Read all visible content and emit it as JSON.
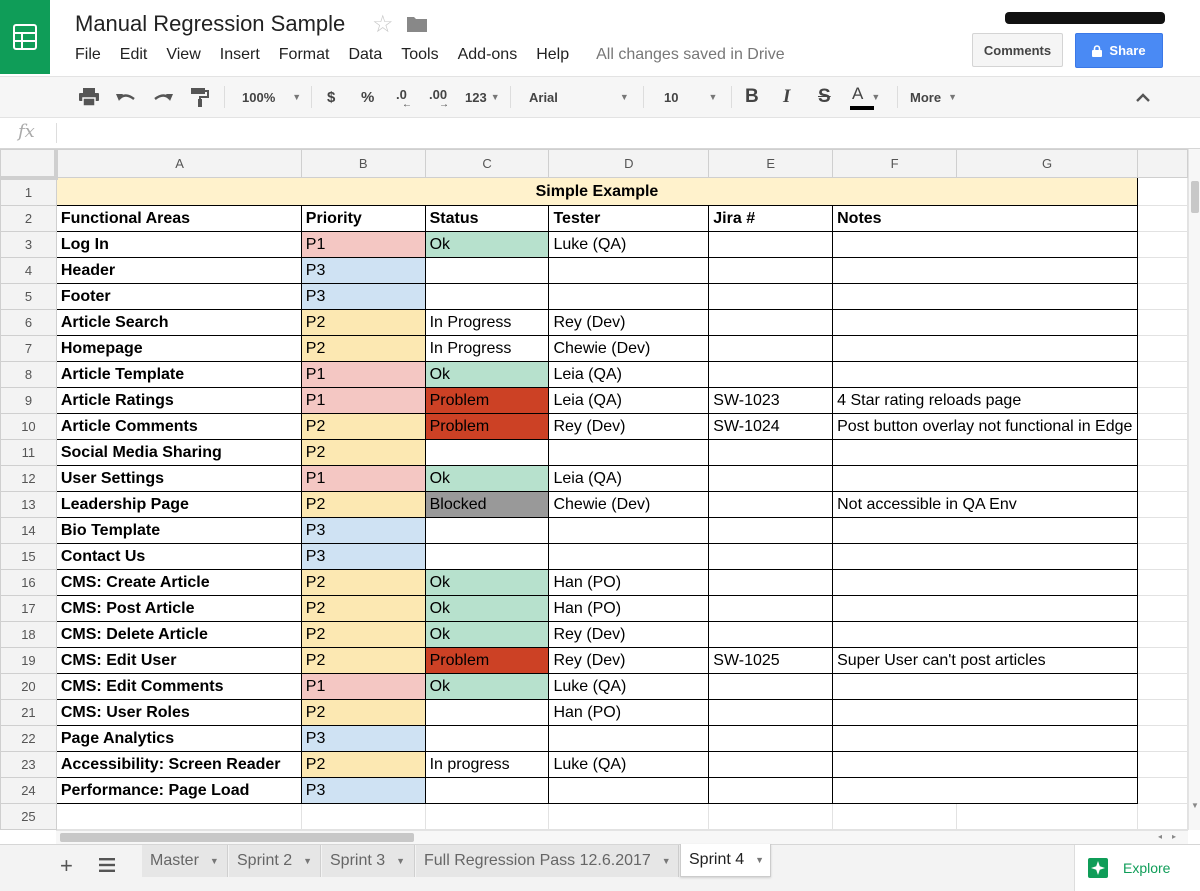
{
  "app": {
    "title": "Manual Regression Sample",
    "save_status": "All changes saved in Drive",
    "menu": [
      "File",
      "Edit",
      "View",
      "Insert",
      "Format",
      "Data",
      "Tools",
      "Add-ons",
      "Help"
    ],
    "comments_label": "Comments",
    "share_label": "Share",
    "accent": "#4a8af4",
    "brand_green": "#0f9d58"
  },
  "toolbar": {
    "zoom": "100%",
    "currency": "$",
    "percent": "%",
    "dec_decrease": ".0",
    "dec_increase": ".00",
    "format_more": "123",
    "font": "Arial",
    "font_size": "10",
    "bold": "B",
    "italic": "I",
    "strike": "S",
    "text_color": "A",
    "more": "More"
  },
  "formula": {
    "fx": "fx",
    "value": ""
  },
  "grid": {
    "columns": [
      "A",
      "B",
      "C",
      "D",
      "E",
      "F",
      "G"
    ],
    "row_numbers": [
      "1",
      "2",
      "3",
      "4",
      "5",
      "6",
      "7",
      "8",
      "9",
      "10",
      "11",
      "12",
      "13",
      "14",
      "15",
      "16",
      "17",
      "18",
      "19",
      "20",
      "21",
      "22",
      "23",
      "24",
      "25"
    ],
    "title": "Simple Example",
    "headers": [
      "Functional Areas",
      "Priority",
      "Status",
      "Tester",
      "Jira #",
      "Notes"
    ],
    "rows": [
      [
        "Log In",
        "P1",
        "Ok",
        "Luke (QA)",
        "",
        ""
      ],
      [
        "Header",
        "P3",
        "",
        "",
        "",
        ""
      ],
      [
        "Footer",
        "P3",
        "",
        "",
        "",
        ""
      ],
      [
        "Article Search",
        "P2",
        "In Progress",
        "Rey (Dev)",
        "",
        ""
      ],
      [
        "Homepage",
        "P2",
        "In Progress",
        "Chewie (Dev)",
        "",
        ""
      ],
      [
        "Article Template",
        "P1",
        "Ok",
        "Leia (QA)",
        "",
        ""
      ],
      [
        "Article Ratings",
        "P1",
        "Problem",
        "Leia (QA)",
        "SW-1023",
        "4 Star rating reloads page"
      ],
      [
        "Article Comments",
        "P2",
        "Problem",
        "Rey (Dev)",
        "SW-1024",
        "Post button overlay not functional in Edge"
      ],
      [
        "Social Media Sharing",
        "P2",
        "",
        "",
        "",
        ""
      ],
      [
        "User Settings",
        "P1",
        "Ok",
        "Leia (QA)",
        "",
        ""
      ],
      [
        "Leadership Page",
        "P2",
        "Blocked",
        "Chewie (Dev)",
        "",
        "Not accessible in QA Env"
      ],
      [
        "Bio Template",
        "P3",
        "",
        "",
        "",
        ""
      ],
      [
        "Contact Us",
        "P3",
        "",
        "",
        "",
        ""
      ],
      [
        "CMS: Create Article",
        "P2",
        "Ok",
        "Han (PO)",
        "",
        ""
      ],
      [
        "CMS: Post Article",
        "P2",
        "Ok",
        "Han (PO)",
        "",
        ""
      ],
      [
        "CMS: Delete Article",
        "P2",
        "Ok",
        "Rey (Dev)",
        "",
        ""
      ],
      [
        "CMS: Edit User",
        "P2",
        "Problem",
        "Rey (Dev)",
        "SW-1025",
        "Super User can't post articles"
      ],
      [
        "CMS: Edit Comments",
        "P1",
        "Ok",
        "Luke (QA)",
        "",
        ""
      ],
      [
        "CMS: User Roles",
        "P2",
        "",
        "Han (PO)",
        "",
        ""
      ],
      [
        "Page Analytics",
        "P3",
        "",
        "",
        "",
        ""
      ],
      [
        "Accessibility: Screen Reader",
        "P2",
        "In progress",
        "Luke (QA)",
        "",
        ""
      ],
      [
        "Performance: Page Load",
        "P3",
        "",
        "",
        "",
        ""
      ]
    ],
    "priority_colors": {
      "P1": "#f4c7c3",
      "P2": "#fce8b2",
      "P3": "#cfe2f3"
    },
    "status_colors": {
      "Ok": "#b7e1cd",
      "Problem": "#cc4125",
      "Blocked": "#999999"
    }
  },
  "sheets": {
    "tabs": [
      "Master",
      "Sprint 2",
      "Sprint 3",
      "Full Regression Pass 12.6.2017",
      "Sprint 4"
    ],
    "active": "Sprint 4",
    "explore_label": "Explore"
  }
}
